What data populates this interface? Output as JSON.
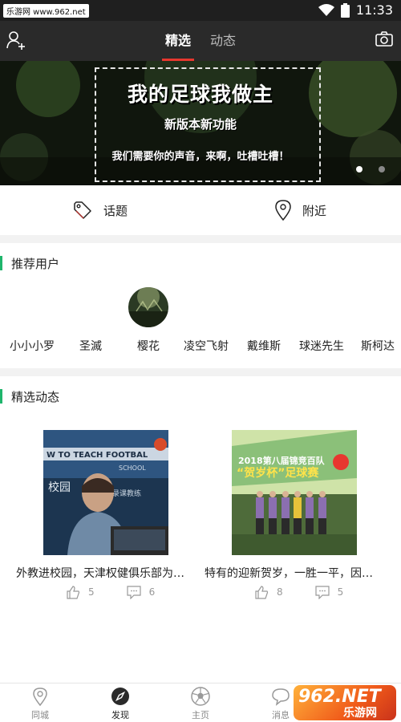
{
  "status_bar": {
    "watermark": "乐游网 www.962.net",
    "time": "11:33",
    "icons": [
      "wifi-icon",
      "battery-icon"
    ]
  },
  "header": {
    "left_icon": "add-user-icon",
    "right_icon": "camera-icon",
    "tabs": [
      {
        "label": "精选",
        "active": true
      },
      {
        "label": "动态",
        "active": false
      }
    ]
  },
  "banner": {
    "title": "我的足球我做主",
    "subtitle": "新版本新功能",
    "slogan": "我们需要你的声音，来啊，吐槽吐槽！",
    "page_count": 2,
    "active_page": 1
  },
  "quick_links": [
    {
      "label": "话题",
      "icon": "tag-icon"
    },
    {
      "label": "附近",
      "icon": "location-pin-icon"
    }
  ],
  "recommended_users": {
    "title": "推荐用户",
    "users": [
      {
        "name": "小小小罗",
        "has_avatar": false
      },
      {
        "name": "圣滅",
        "has_avatar": false
      },
      {
        "name": "樱花",
        "has_avatar": true
      },
      {
        "name": "凌空飞射",
        "has_avatar": false
      },
      {
        "name": "戴维斯",
        "has_avatar": false
      },
      {
        "name": "球迷先生",
        "has_avatar": false
      },
      {
        "name": "斯柯达",
        "has_avatar": false
      }
    ]
  },
  "featured": {
    "title": "精选动态",
    "posts": [
      {
        "caption": "外教进校园，天津权健俱乐部为…",
        "likes": "5",
        "comments": "6",
        "image_text": "W TO TEACH FOOTBAL SCHOOL 校园 录课教练"
      },
      {
        "caption": "特有的迎新贺岁，一胜一平，因…",
        "likes": "8",
        "comments": "5",
        "image_text": "2018第八届锦竞百队 “贺岁杯”足球赛"
      }
    ]
  },
  "bottom_nav": {
    "items": [
      {
        "label": "同城",
        "icon": "location-icon",
        "active": false
      },
      {
        "label": "发现",
        "icon": "compass-icon",
        "active": true
      },
      {
        "label": "主页",
        "icon": "soccer-ball-icon",
        "active": false
      },
      {
        "label": "消息",
        "icon": "chat-bubble-icon",
        "active": false
      },
      {
        "label": "",
        "icon": "",
        "active": false
      }
    ]
  },
  "corner_watermark": {
    "line1": "962.NET",
    "line2": "乐游网"
  },
  "colors": {
    "header_bg": "#2a2a2a",
    "tab_indicator": "#e8372f",
    "section_accent": "#1fb56c",
    "status_bar_bg": "#1f1f1f"
  }
}
